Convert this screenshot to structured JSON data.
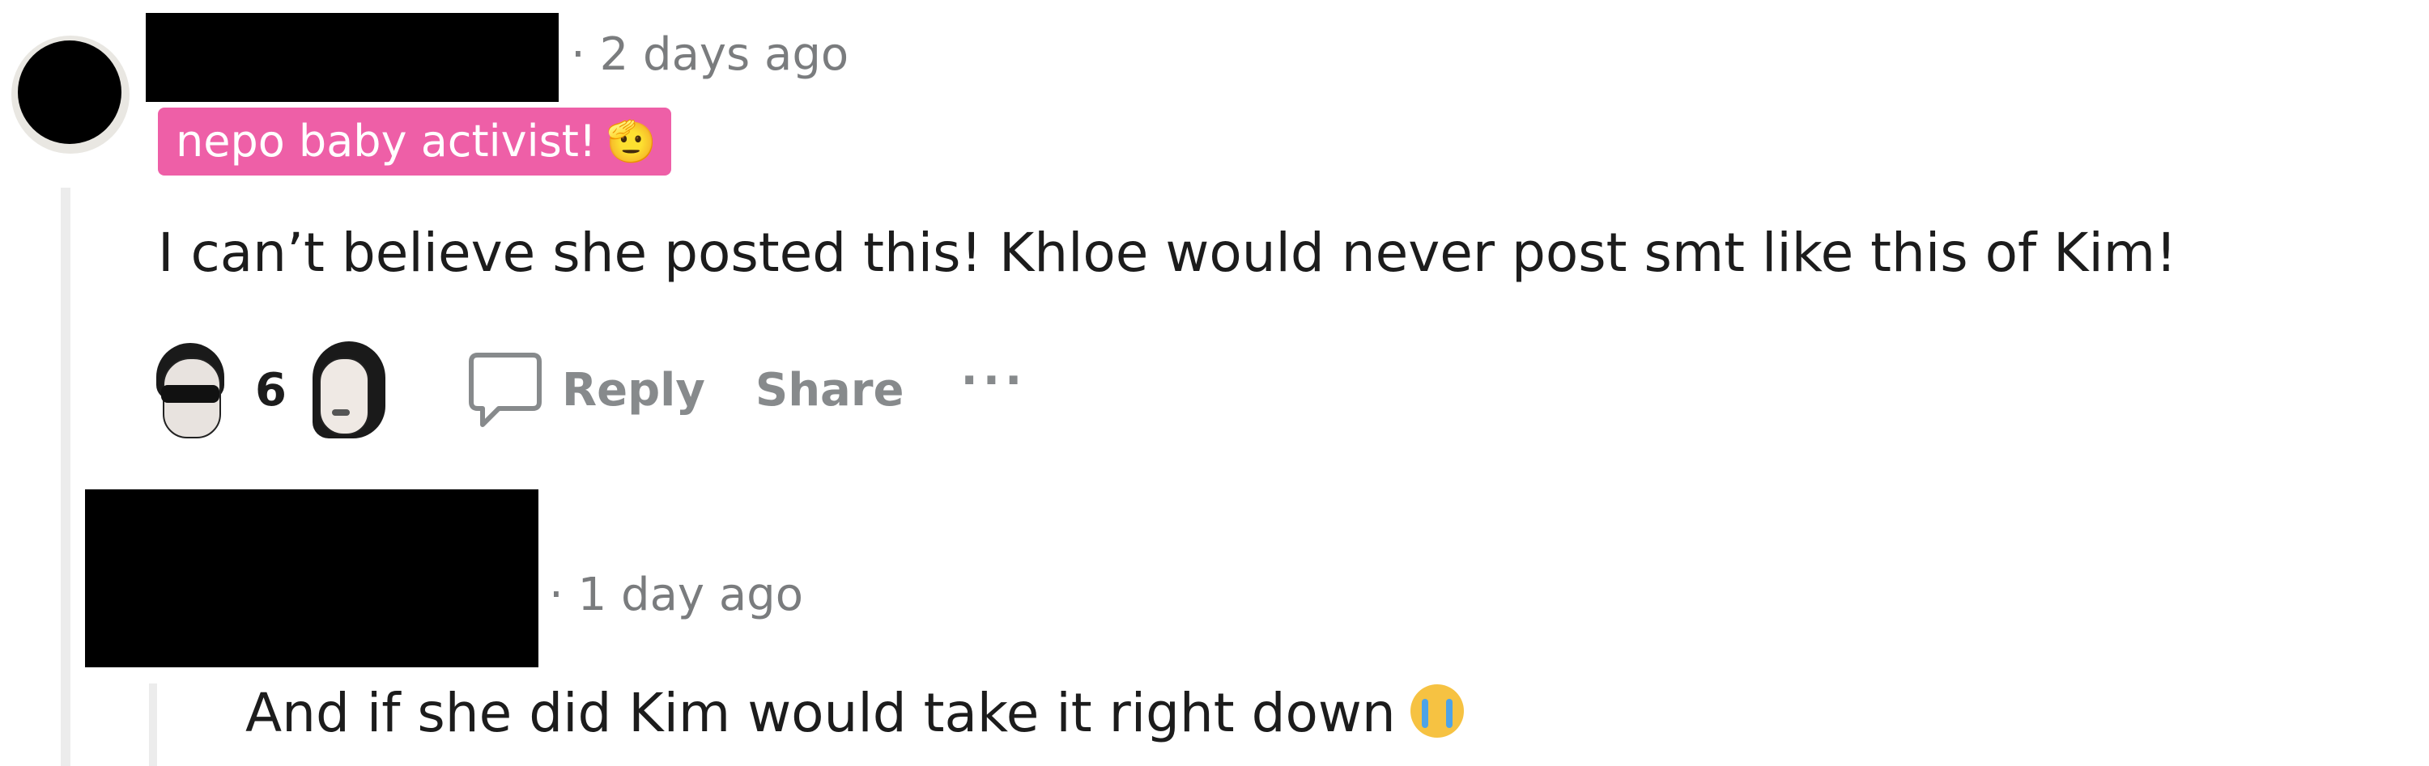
{
  "comment": {
    "timestamp": "· 2 days ago",
    "flair": {
      "label": "nepo baby activist!",
      "emoji": "🫡"
    },
    "text": "I can’t believe she posted this! Khloe would never post smt like this of Kim!",
    "actions": {
      "vote_count": "6",
      "reply_label": "Reply",
      "share_label": "Share",
      "more_label": "···"
    }
  },
  "reply": {
    "timestamp": "· 1 day ago",
    "text": "And if she did Kim would take it right down"
  },
  "icons": {
    "upvote": "kris-jenner-face-icon",
    "downvote": "kim-kardashian-face-icon",
    "reply": "speech-bubble-icon",
    "reply_emoji": "loudly-crying-face-icon"
  },
  "colors": {
    "flair_background": "#ee5fa7",
    "muted_text": "#878a8c",
    "body_text": "#1c1c1c",
    "thread_line": "#ececec"
  }
}
